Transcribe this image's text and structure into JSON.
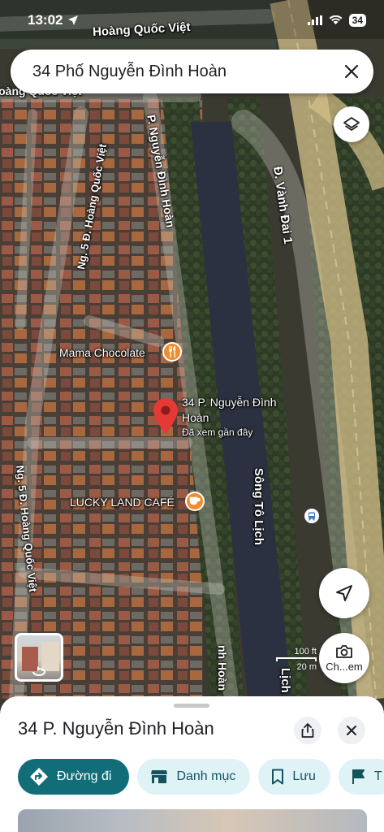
{
  "status_bar": {
    "time": "13:02",
    "battery": "34"
  },
  "search": {
    "query": "34 Phố Nguyễn Đình Hoàn"
  },
  "map": {
    "labels": {
      "hoang_quoc_viet_top": "Hoàng Quốc Việt",
      "hoang_quoc_viet_left": "Hoàng Quốc Việt",
      "ng5_hqv_top": "Ng. 5 Đ. Hoàng Quốc Việt",
      "ng5_hqv_bottom": "Ng. 5 Đ. Hoàng Quốc Việt",
      "nguyen_dinh_hoan_street": "P. Nguyễn Đình Hoàn",
      "nguyen_dinh_hoan_street_bottom": "nh Hoàn",
      "vanh_dai_1": "Đ. Vành Đai 1",
      "song_to_lich": "Sông Tô Lịch",
      "song_to_lich_bottom": "Lịch"
    },
    "pois": {
      "mama_chocolate": "Mama Chocolate",
      "lucky_land": "LUCKY LAND CAFÉ"
    },
    "selected_pin": {
      "line1": "34 P. Nguyễn Đình",
      "line2": "Hoàn",
      "subtext": "Đã xem gần đây"
    },
    "scale": {
      "top": "100 ft",
      "bottom": "20 m"
    },
    "compass_button_label": "Ch...em"
  },
  "sheet": {
    "title": "34 P. Nguyễn Đình Hoàn",
    "chips": {
      "directions": "Đường đi",
      "categories": "Danh mục",
      "save": "Lưu",
      "more": "T"
    }
  },
  "colors": {
    "primary": "#116d78",
    "chip_bg": "#dff3f6",
    "pin": "#e53935",
    "poi": "#f08c2b"
  }
}
